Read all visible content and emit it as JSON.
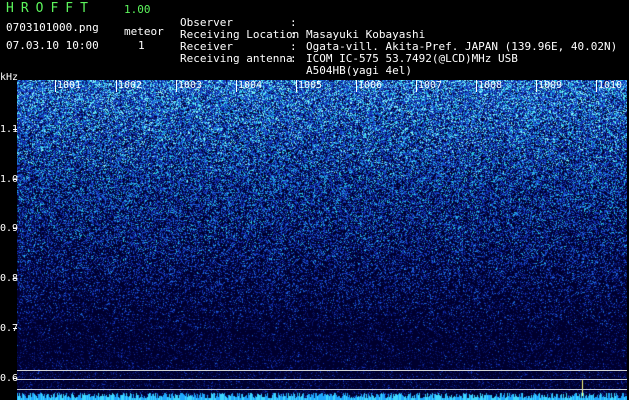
{
  "app": {
    "title": "HROFFT",
    "version": "1.00"
  },
  "file": {
    "name": "0703101000.png",
    "datetime": "07.03.10 10:00"
  },
  "counter": {
    "label": "meteor",
    "value": "1"
  },
  "info": [
    {
      "label": "Observer",
      "value": "Masayuki Kobayashi"
    },
    {
      "label": "Receiving Location",
      "value": "Ogata-vill. Akita-Pref. JAPAN (139.96E, 40.02N)"
    },
    {
      "label": "Receiver",
      "value": "ICOM IC-575 53.7492(@LCD)MHz USB"
    },
    {
      "label": "Receiving antenna",
      "value": "A504HB(yagi 4el)"
    }
  ],
  "spectrogram": {
    "y_unit": "kHz",
    "y_ticks": [
      "1.1",
      "1.0",
      "0.9",
      "0.8",
      "0.7",
      "0.6"
    ],
    "x_ticks": [
      "1001",
      "1002",
      "1003",
      "1004",
      "1005",
      "1006",
      "1007",
      "1008",
      "1009",
      "1010"
    ],
    "colors": {
      "background": "#00002e",
      "noise_low": "#1a3fd0",
      "noise_high": "#7ff0ff",
      "text": "#ffffff",
      "title": "#5cf55c"
    }
  }
}
